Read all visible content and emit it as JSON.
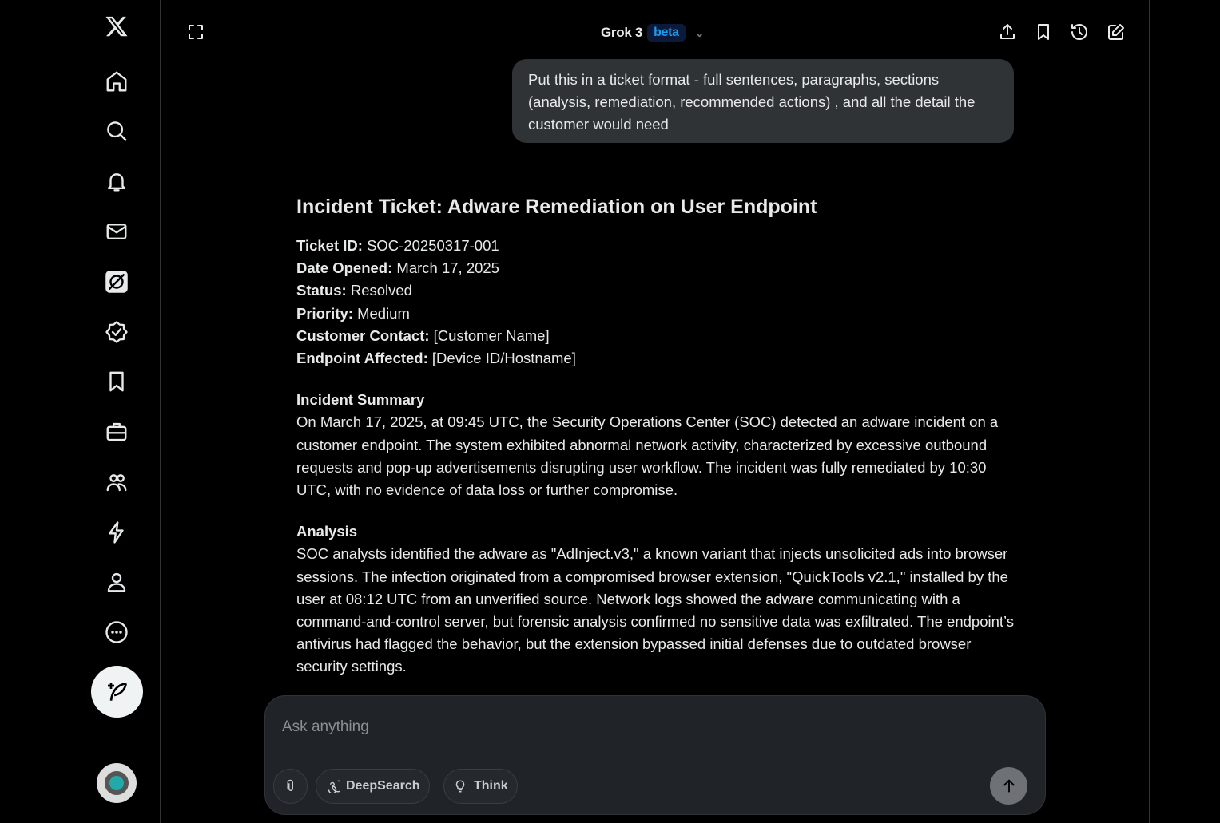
{
  "header": {
    "title": "Grok 3",
    "badge": "beta"
  },
  "user_message": "Put this in a ticket format - full sentences, paragraphs, sections (analysis, remediation, recommended actions) , and all the detail the customer would need",
  "ticket": {
    "title": "Incident Ticket: Adware Remediation on User Endpoint",
    "fields": [
      {
        "label": "Ticket ID:",
        "value": " SOC-20250317-001"
      },
      {
        "label": "Date Opened:",
        "value": " March 17, 2025"
      },
      {
        "label": "Status:",
        "value": " Resolved"
      },
      {
        "label": "Priority:",
        "value": " Medium"
      },
      {
        "label": "Customer Contact:",
        "value": " [Customer Name]"
      },
      {
        "label": "Endpoint Affected:",
        "value": " [Device ID/Hostname]"
      }
    ],
    "summary_heading": "Incident Summary",
    "summary": "On March 17, 2025, at 09:45 UTC, the Security Operations Center (SOC) detected an adware incident on a customer endpoint. The system exhibited abnormal network activity, characterized by excessive outbound requests and pop-up advertisements disrupting user workflow. The incident was fully remediated by 10:30 UTC, with no evidence of data loss or further compromise.",
    "analysis_heading": "Analysis",
    "analysis": "SOC analysts identified the adware as \"AdInject.v3,\" a known variant that injects unsolicited ads into browser sessions. The infection originated from a compromised browser extension, \"QuickTools v2.1,\" installed by the user at 08:12 UTC from an unverified source. Network logs showed the adware communicating with a command-and-control server, but forensic analysis confirmed no sensitive data was exfiltrated. The endpoint’s antivirus had flagged the behavior, but the extension bypassed initial defenses due to outdated browser security settings."
  },
  "composer": {
    "placeholder": "Ask anything",
    "deepsearch": "DeepSearch",
    "think": "Think"
  }
}
